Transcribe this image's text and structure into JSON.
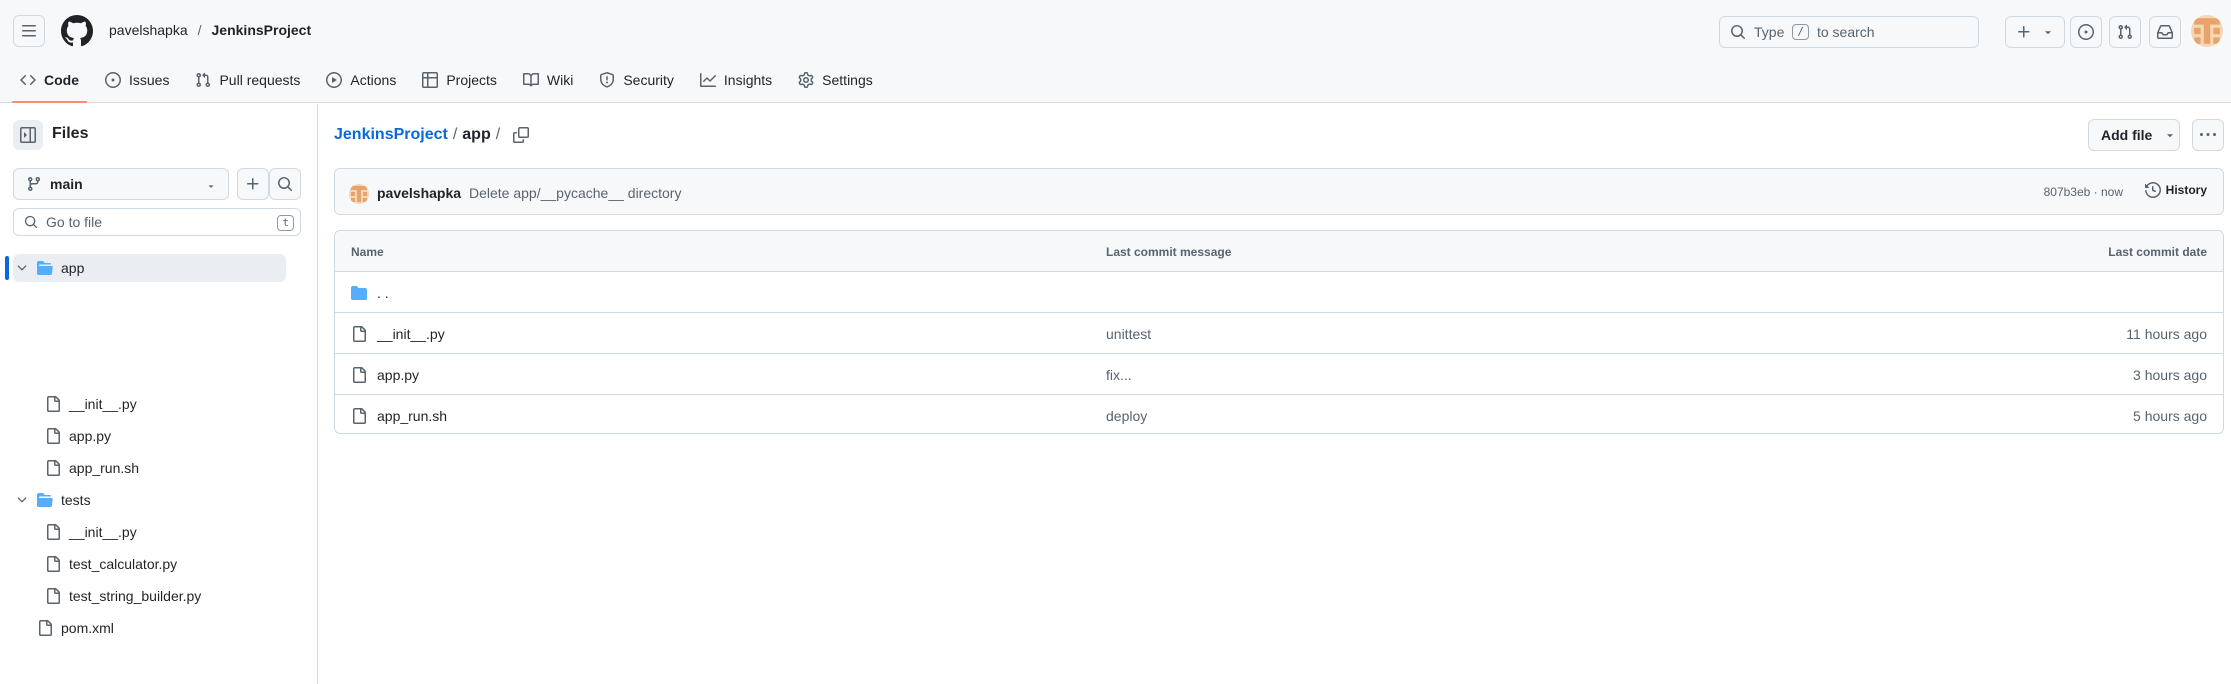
{
  "header": {
    "owner": "pavelshapka",
    "separator": "/",
    "repo": "JenkinsProject",
    "search": {
      "prefix": "Type",
      "key": "/",
      "suffix": "to search"
    },
    "avatar_colors": [
      "#e8a36a",
      "#f4d7b5"
    ]
  },
  "repo_nav": {
    "tabs": [
      {
        "label": "Code",
        "icon": "code-icon",
        "selected": true
      },
      {
        "label": "Issues",
        "icon": "issue-opened-icon"
      },
      {
        "label": "Pull requests",
        "icon": "git-pull-request-icon"
      },
      {
        "label": "Actions",
        "icon": "play-icon"
      },
      {
        "label": "Projects",
        "icon": "table-icon"
      },
      {
        "label": "Wiki",
        "icon": "book-icon"
      },
      {
        "label": "Security",
        "icon": "shield-icon"
      },
      {
        "label": "Insights",
        "icon": "graph-icon"
      },
      {
        "label": "Settings",
        "icon": "gear-icon"
      }
    ],
    "accent": "#fd8c73"
  },
  "sidebar": {
    "title": "Files",
    "branch": "main",
    "goto_placeholder": "Go to file",
    "goto_key": "t",
    "tree": [
      {
        "label": "app",
        "type": "folder",
        "expanded": true,
        "active": true
      },
      {
        "label": "__init__.py",
        "type": "file"
      },
      {
        "label": "app.py",
        "type": "file"
      },
      {
        "label": "app_run.sh",
        "type": "file"
      },
      {
        "label": "tests",
        "type": "folder",
        "expanded": true
      },
      {
        "label": "__init__.py",
        "type": "file"
      },
      {
        "label": "test_calculator.py",
        "type": "file"
      },
      {
        "label": "test_string_builder.py",
        "type": "file"
      },
      {
        "label": "pom.xml",
        "type": "file"
      }
    ]
  },
  "main": {
    "breadcrumb": {
      "repo": "JenkinsProject",
      "sep": "/",
      "dir": "app",
      "trail": "/"
    },
    "add_file_label": "Add file",
    "latest_commit": {
      "author": "pavelshapka",
      "message": "Delete app/__pycache__ directory",
      "meta": "807b3eb · now",
      "history_label": "History"
    },
    "table": {
      "headers": {
        "name": "Name",
        "message": "Last commit message",
        "date": "Last commit date"
      },
      "parent_label": ". .",
      "rows": [
        {
          "name": "__init__.py",
          "message": "unittest",
          "date": "11 hours ago"
        },
        {
          "name": "app.py",
          "message": "fix...",
          "date": "3 hours ago"
        },
        {
          "name": "app_run.sh",
          "message": "deploy",
          "date": "5 hours ago"
        }
      ]
    },
    "link_color": "#0969da",
    "folder_color": "#54aeff"
  }
}
